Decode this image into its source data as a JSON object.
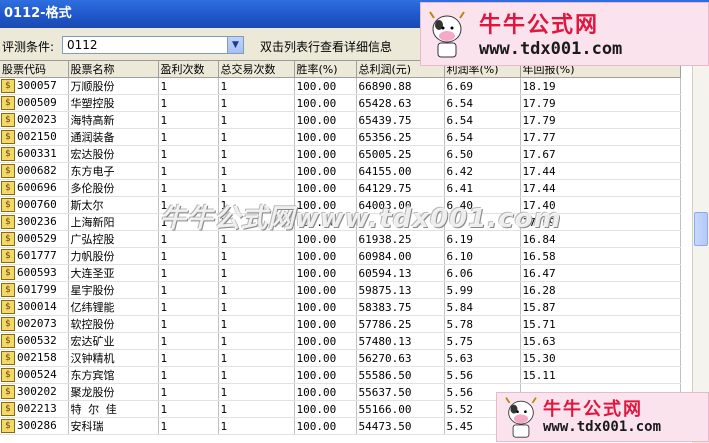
{
  "window": {
    "title": "0112-格式"
  },
  "toolbar": {
    "criteria_label": "评测条件:",
    "criteria_value": "0112",
    "hint": "双击列表行查看详细信息"
  },
  "columns": [
    "股票代码",
    "股票名称",
    "盈利次数",
    "总交易次数",
    "胜率(%)",
    "总利润(元)",
    "利润率(%)",
    "年回报(%)"
  ],
  "rows": [
    [
      "300057",
      "万顺股份",
      "1",
      "1",
      "100.00",
      "66890.88",
      "6.69",
      "18.19"
    ],
    [
      "000509",
      "华塑控股",
      "1",
      "1",
      "100.00",
      "65428.63",
      "6.54",
      "17.79"
    ],
    [
      "002023",
      "海特高新",
      "1",
      "1",
      "100.00",
      "65439.75",
      "6.54",
      "17.79"
    ],
    [
      "002150",
      "通润装备",
      "1",
      "1",
      "100.00",
      "65356.25",
      "6.54",
      "17.77"
    ],
    [
      "600331",
      "宏达股份",
      "1",
      "1",
      "100.00",
      "65005.25",
      "6.50",
      "17.67"
    ],
    [
      "000682",
      "东方电子",
      "1",
      "1",
      "100.00",
      "64155.00",
      "6.42",
      "17.44"
    ],
    [
      "600696",
      "多伦股份",
      "1",
      "1",
      "100.00",
      "64129.75",
      "6.41",
      "17.44"
    ],
    [
      "000760",
      "斯太尔",
      "1",
      "1",
      "100.00",
      "64003.00",
      "6.40",
      "17.40"
    ],
    [
      "300236",
      "上海新阳",
      "1",
      "1",
      "100.00",
      "",
      "",
      "17.09"
    ],
    [
      "000529",
      "广弘控股",
      "1",
      "1",
      "100.00",
      "61938.25",
      "6.19",
      "16.84"
    ],
    [
      "601777",
      "力帆股份",
      "1",
      "1",
      "100.00",
      "60984.00",
      "6.10",
      "16.58"
    ],
    [
      "600593",
      "大连圣亚",
      "1",
      "1",
      "100.00",
      "60594.13",
      "6.06",
      "16.47"
    ],
    [
      "601799",
      "星宇股份",
      "1",
      "1",
      "100.00",
      "59875.13",
      "5.99",
      "16.28"
    ],
    [
      "300014",
      "亿纬锂能",
      "1",
      "1",
      "100.00",
      "58383.75",
      "5.84",
      "15.87"
    ],
    [
      "002073",
      "软控股份",
      "1",
      "1",
      "100.00",
      "57786.25",
      "5.78",
      "15.71"
    ],
    [
      "600532",
      "宏达矿业",
      "1",
      "1",
      "100.00",
      "57480.13",
      "5.75",
      "15.63"
    ],
    [
      "002158",
      "汉钟精机",
      "1",
      "1",
      "100.00",
      "56270.63",
      "5.63",
      "15.30"
    ],
    [
      "000524",
      "东方宾馆",
      "1",
      "1",
      "100.00",
      "55586.50",
      "5.56",
      "15.11"
    ],
    [
      "300202",
      "聚龙股份",
      "1",
      "1",
      "100.00",
      "55637.50",
      "5.56",
      ""
    ],
    [
      "002213",
      "特 尔 佳",
      "1",
      "1",
      "100.00",
      "55166.00",
      "5.52",
      ""
    ],
    [
      "300286",
      "安科瑞",
      "1",
      "1",
      "100.00",
      "54473.50",
      "5.45",
      ""
    ]
  ],
  "watermarks": {
    "brand": "牛牛公式网",
    "url": "www.tdx001.com",
    "center": "牛牛公式网www.tdx001.com"
  },
  "colors": {
    "titlebar": "#1E55C8",
    "brand_red": "#E0163F",
    "badge_bg": "#FBE3EE"
  }
}
